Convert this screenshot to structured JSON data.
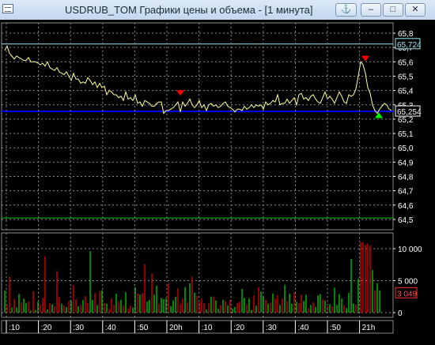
{
  "window": {
    "title": "USDRUB_TOM Графики цены и объема - [1 минута]",
    "anchor_icon": "anchor-icon",
    "buttons": {
      "minimize": "–",
      "maximize": "□",
      "close": "✕"
    }
  },
  "colors": {
    "background": "#000000",
    "price_line": "#ffff99",
    "grid": "#8a8a8a",
    "level_blue": "#0000ff",
    "level_cyan": "#9de6f0",
    "level_green": "#00c800",
    "volume_up": "#00c000",
    "volume_down": "#d00000",
    "axis_text": "#ffffff",
    "sell_marker": "#ff0000",
    "buy_marker": "#00ff00"
  },
  "chart_data": [
    {
      "type": "line",
      "name": "price",
      "yticks": [
        "65,8",
        "65,7",
        "65,6",
        "65,5",
        "65,4",
        "65,3",
        "65,2",
        "65,1",
        "65,0",
        "64,9",
        "64,8",
        "64,7",
        "64,6",
        "64,5"
      ],
      "ylim": [
        64.45,
        65.82
      ],
      "price_badges": [
        "65,724",
        "65,254"
      ],
      "levels": [
        {
          "value": 65.724,
          "color": "cyan"
        },
        {
          "value": 65.254,
          "color": "blue"
        },
        {
          "value": 64.51,
          "color": "green"
        }
      ],
      "x": [
        0,
        3,
        6,
        9,
        12,
        15,
        18,
        21,
        24,
        27,
        30,
        33,
        36,
        39,
        42,
        45,
        48,
        51,
        54,
        57,
        60,
        63,
        66,
        69,
        72,
        75,
        78,
        81,
        84,
        87,
        90,
        93,
        96,
        99,
        102,
        105,
        108,
        111,
        114,
        117,
        120,
        123,
        126,
        129,
        132,
        135,
        138,
        141,
        144,
        147,
        150,
        153,
        156,
        159,
        162,
        165,
        168,
        171,
        174,
        177,
        180,
        183,
        186,
        189,
        192,
        195,
        198,
        201,
        204,
        207,
        210,
        213,
        216,
        219,
        222,
        225,
        228,
        231,
        234,
        237,
        240,
        243,
        246,
        249,
        252,
        255,
        258,
        261,
        264,
        267,
        270,
        273,
        276,
        279,
        282,
        285,
        288,
        291,
        294,
        297,
        300,
        303,
        306,
        309,
        312,
        315,
        318,
        321,
        324,
        327,
        330,
        333,
        336,
        339,
        342,
        345,
        348,
        351,
        354,
        357,
        360,
        363,
        366,
        369,
        372,
        375,
        378,
        381,
        384,
        387,
        390,
        393,
        396,
        399,
        402,
        405,
        408,
        411,
        414,
        417,
        420,
        423,
        426,
        429,
        432,
        435,
        438,
        441,
        444,
        447,
        450,
        453,
        456,
        459,
        462,
        465,
        468,
        471,
        474,
        477,
        480,
        483,
        486,
        489
      ],
      "values": [
        65.68,
        65.71,
        65.66,
        65.64,
        65.62,
        65.64,
        65.63,
        65.62,
        65.61,
        65.61,
        65.63,
        65.6,
        65.6,
        65.6,
        65.59,
        65.58,
        65.59,
        65.57,
        65.6,
        65.56,
        65.55,
        65.54,
        65.56,
        65.53,
        65.52,
        65.51,
        65.53,
        65.5,
        65.47,
        65.52,
        65.48,
        65.48,
        65.45,
        65.46,
        65.45,
        65.49,
        65.47,
        65.44,
        65.46,
        65.42,
        65.45,
        65.42,
        65.43,
        65.37,
        65.4,
        65.39,
        65.37,
        65.37,
        65.35,
        65.36,
        65.33,
        65.39,
        65.34,
        65.35,
        65.33,
        65.37,
        65.31,
        65.32,
        65.29,
        65.33,
        65.32,
        65.31,
        65.29,
        65.29,
        65.31,
        65.32,
        65.32,
        65.24,
        65.26,
        65.26,
        65.27,
        65.28,
        65.3,
        65.32,
        65.25,
        65.32,
        65.29,
        65.31,
        65.34,
        65.3,
        65.28,
        65.3,
        65.33,
        65.28,
        65.3,
        65.26,
        65.3,
        65.31,
        65.29,
        65.3,
        65.28,
        65.29,
        65.31,
        65.32,
        65.29,
        65.28,
        65.27,
        65.25,
        65.27,
        65.27,
        65.26,
        65.29,
        65.27,
        65.28,
        65.3,
        65.28,
        65.3,
        65.29,
        65.3,
        65.27,
        65.32,
        65.3,
        65.31,
        65.33,
        65.32,
        65.37,
        65.3,
        65.31,
        65.31,
        65.34,
        65.31,
        65.33,
        65.35,
        65.3,
        65.37,
        65.38,
        65.34,
        65.35,
        65.33,
        65.36,
        65.37,
        65.34,
        65.32,
        65.31,
        65.35,
        65.39,
        65.34,
        65.36,
        65.34,
        65.31,
        65.35,
        65.39,
        65.36,
        65.32,
        65.31,
        65.37,
        65.36,
        65.37,
        65.41,
        65.5,
        65.6,
        65.58,
        65.52,
        65.42,
        65.38,
        65.3,
        65.26,
        65.24,
        65.27,
        65.29,
        65.31,
        65.3,
        65.27,
        65.26
      ],
      "markers": [
        {
          "type": "sell",
          "x": 222,
          "value": 65.38
        },
        {
          "type": "sell",
          "x": 456,
          "value": 65.62
        },
        {
          "type": "buy",
          "x": 473,
          "value": 65.23
        }
      ]
    },
    {
      "type": "bar",
      "name": "volume",
      "yticks": [
        "10 000",
        "5 000",
        "0"
      ],
      "ylim": [
        0,
        11000
      ],
      "current_badge": "3 049",
      "values": [
        3500,
        1200,
        5600,
        800,
        2100,
        800,
        2900,
        1600,
        2200,
        1500,
        1700,
        300,
        3300,
        400,
        1700,
        1200,
        2300,
        8800,
        500,
        1500,
        1300,
        1000,
        6500,
        2400,
        1400,
        1100,
        900,
        1800,
        1900,
        4300,
        2100,
        1000,
        1200,
        2000,
        2600,
        1500,
        9600,
        2000,
        3100,
        1200,
        3400,
        3500,
        1500,
        1400,
        600,
        2200,
        1200,
        3000,
        1700,
        2000,
        1100,
        3200,
        600,
        1100,
        800,
        4000,
        3000,
        2800,
        3000,
        7600,
        1700,
        2000,
        6100,
        2800,
        4200,
        1400,
        2300,
        2100,
        2300,
        4600,
        1000,
        1900,
        2500,
        3800,
        1400,
        2200,
        4000,
        1600,
        4600,
        5600,
        3100,
        2600,
        1600,
        2200,
        1500,
        500,
        1500,
        2500,
        2500,
        1900,
        600,
        1200,
        2000,
        1800,
        1100,
        2000,
        600,
        900,
        1500,
        1700,
        3700,
        2300,
        1300,
        2200,
        400,
        2700,
        1100,
        4000,
        3300,
        2600,
        2000,
        1400,
        1600,
        3000,
        2200,
        2700,
        1200,
        2200,
        4300,
        1800,
        3000,
        1400,
        3200,
        1700,
        1500,
        2800,
        1800,
        2800,
        700,
        1200,
        1600,
        900,
        2700,
        2900,
        2100,
        1900,
        1000,
        1300,
        1000,
        3900,
        1200,
        2900,
        2200,
        1200,
        700,
        3100,
        8400,
        1400,
        1300,
        5300,
        11000,
        11000,
        10600,
        10800,
        10500,
        6700,
        3500,
        4600,
        3500
      ],
      "colors": [
        "g",
        "r",
        "r",
        "g",
        "r",
        "g",
        "g",
        "r",
        "g",
        "g",
        "r",
        "g",
        "r",
        "g",
        "g",
        "r",
        "r",
        "r",
        "g",
        "r",
        "g",
        "r",
        "r",
        "r",
        "g",
        "r",
        "g",
        "r",
        "g",
        "r",
        "r",
        "g",
        "r",
        "g",
        "r",
        "r",
        "g",
        "g",
        "r",
        "g",
        "r",
        "g",
        "r",
        "g",
        "r",
        "r",
        "r",
        "g",
        "r",
        "g",
        "r",
        "g",
        "r",
        "r",
        "g",
        "g",
        "r",
        "g",
        "r",
        "r",
        "g",
        "g",
        "r",
        "g",
        "g",
        "r",
        "g",
        "g",
        "g",
        "r",
        "g",
        "g",
        "g",
        "r",
        "r",
        "r",
        "g",
        "r",
        "g",
        "r",
        "g",
        "r",
        "r",
        "r",
        "r",
        "g",
        "r",
        "g",
        "r",
        "g",
        "g",
        "r",
        "g",
        "r",
        "g",
        "r",
        "g",
        "g",
        "r",
        "r",
        "g",
        "g",
        "r",
        "g",
        "g",
        "r",
        "g",
        "r",
        "g",
        "g",
        "r",
        "g",
        "r",
        "g",
        "r",
        "r",
        "g",
        "r",
        "g",
        "r",
        "g",
        "g",
        "r",
        "g",
        "r",
        "r",
        "g",
        "g",
        "r",
        "g",
        "r",
        "g",
        "g",
        "g",
        "r",
        "g",
        "r",
        "g",
        "r",
        "g",
        "g",
        "g",
        "g",
        "r",
        "g",
        "g",
        "g",
        "g",
        "r",
        "g",
        "r",
        "r",
        "r",
        "r",
        "r",
        "g",
        "r",
        "g",
        "g"
      ]
    }
  ],
  "time_axis": {
    "labels": [
      ":10",
      ":20",
      ":30",
      ":40",
      ":50",
      "20h",
      ":10",
      ":20",
      ":30",
      ":40",
      ":50",
      "21h"
    ]
  }
}
